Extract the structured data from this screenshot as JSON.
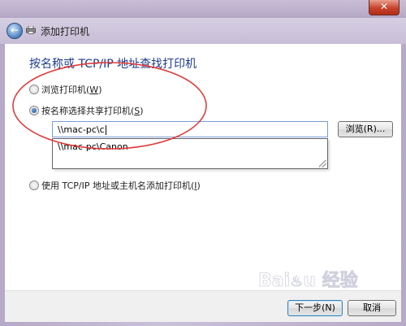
{
  "window": {
    "title": "添加打印机",
    "close_glyph": "✕"
  },
  "nav": {
    "back_glyph": "←"
  },
  "heading": "按名称或 TCP/IP 地址查找打印机",
  "options": {
    "browse_label": "浏览打印机(",
    "browse_key": "W",
    "browse_close": ")",
    "share_label": "按名称选择共享打印机(",
    "share_key": "S",
    "share_close": ")",
    "tcp_label": "使用 TCP/IP 地址或主机名添加打印机(",
    "tcp_key": "I",
    "tcp_close": ")"
  },
  "share_input": {
    "value": "\\\\mac-pc\\c"
  },
  "autocomplete": {
    "items": [
      "\\\\mac-pc\\Canon"
    ]
  },
  "buttons": {
    "browse": "浏览(R)...",
    "next": "下一步(N)",
    "cancel": "取消"
  },
  "watermark": {
    "text": "Baidu 经验"
  },
  "colors": {
    "heading": "#1f3c88",
    "annotation": "#e03c3c",
    "close_button": "#c8412b"
  },
  "icons": {
    "back": "back-arrow-icon",
    "printer": "printer-icon",
    "close": "close-icon"
  }
}
